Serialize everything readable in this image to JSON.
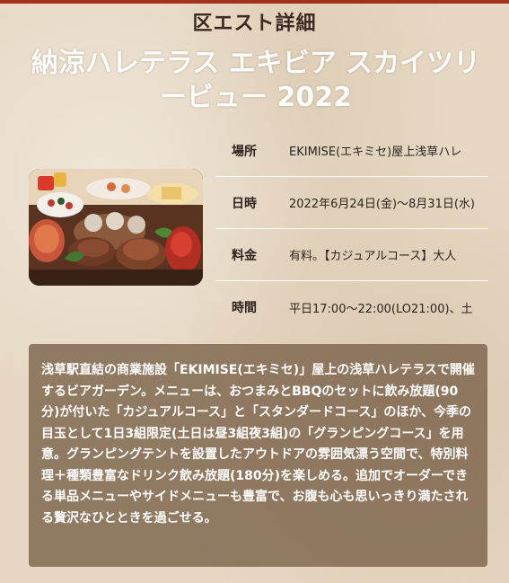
{
  "section": {
    "title": "区エスト詳細"
  },
  "event": {
    "title": "納涼ハレテラス エキビア スカイツリービュー 2022"
  },
  "photo": {
    "icon": "bbq-food-photo"
  },
  "info": {
    "rows": [
      {
        "label": "場所",
        "value": "EKIMISE(エキミセ)屋上浅草ハレ"
      },
      {
        "label": "日時",
        "value": "2022年6月24日(金)～8月31日(水)"
      },
      {
        "label": "料金",
        "value": "有料。【カジュアルコース】大人"
      },
      {
        "label": "時間",
        "value": "平日17:00～22:00(LO21:00)、土"
      }
    ]
  },
  "description": {
    "text": "浅草駅直結の商業施設「EKIMISE(エキミセ)」屋上の浅草ハレテラスで開催するビアガーデン。メニューは、おつまみとBBQのセットに飲み放題(90分)が付いた「カジュアルコース」と「スタンダードコース」のほか、今季の目玉として1日3組限定(土日は昼3組夜3組)の「グランピングコース」を用意。グランピングテントを設置したアウトドアの雰囲気漂う空間で、特別料理＋種類豊富なドリンク飲み放題(180分)を楽しめる。追加でオーダーできる単品メニューやサイドメニューも豊富で、お腹も心も思いっきり満たされる贅沢なひとときを過ごせる。"
  },
  "colors": {
    "accent_bar": "#a5301e",
    "background": "#e6d8c3",
    "description_bg": "#7a5f46"
  }
}
